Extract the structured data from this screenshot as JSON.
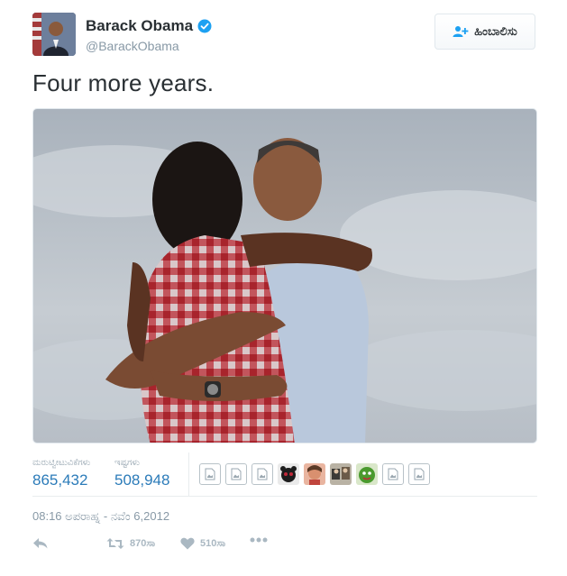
{
  "author": {
    "name": "Barack Obama",
    "handle": "@BarackObama",
    "verified": true
  },
  "follow_button": {
    "label": "ಹಿಂಬಾಲಿಸು",
    "icon": "add-user-icon"
  },
  "tweet": {
    "text": "Four more years."
  },
  "photo": {
    "icon": "photo"
  },
  "stats": {
    "retweets_label": "ಮರುಟ್ವೀಟುವಿಕೆಗಳು",
    "retweets_value": "865,432",
    "likes_label": "ಇಷ್ಟಗಳು",
    "likes_value": "508,948"
  },
  "timestamp": "08:16 ಅಪರಾಹ್ನ - ನವೆಂ 6,2012",
  "actions": {
    "reply_icon": "reply-icon",
    "retweet_icon": "retweet-icon",
    "retweet_count": "870ಸಾ",
    "like_icon": "heart-icon",
    "like_count": "510ಸಾ",
    "more_icon": "more-icon"
  },
  "colors": {
    "link_blue": "#2b7bb9",
    "verified_blue": "#1da1f2",
    "muted_gray": "#8899a6",
    "icon_gray": "#aab8c2"
  }
}
